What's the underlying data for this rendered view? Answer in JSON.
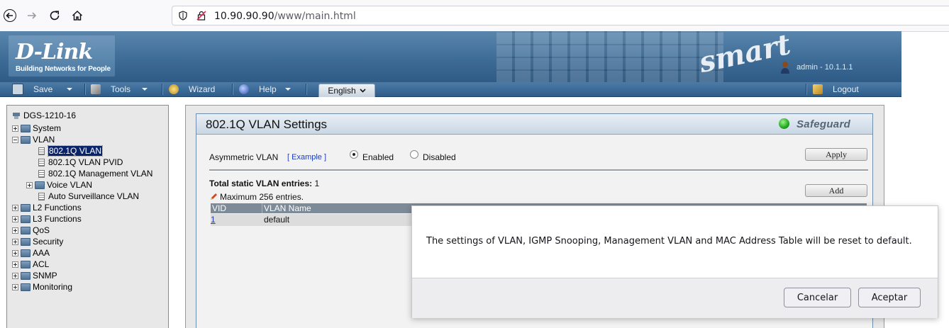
{
  "browser": {
    "url_host": "10.90.90.90",
    "url_path": "/www/main.html",
    "icons": [
      "back-arrow-icon",
      "forward-arrow-icon",
      "reload-icon",
      "home-icon",
      "shield-icon",
      "insecure-lock-icon"
    ]
  },
  "header": {
    "logo_text": "D-Link",
    "logo_tagline": "Building Networks for People",
    "smart_logo": "smart",
    "user": "admin - 10.1.1.1"
  },
  "toolbar": {
    "save": "Save",
    "tools": "Tools",
    "wizard": "Wizard",
    "help": "Help",
    "language": "English",
    "logout": "Logout"
  },
  "tree": {
    "root": "DGS-1210-16",
    "system": "System",
    "vlan": "VLAN",
    "vlan_8021q": "802.1Q VLAN",
    "vlan_pvid": "802.1Q VLAN PVID",
    "vlan_mgmt": "802.1Q Management VLAN",
    "voice_vlan": "Voice VLAN",
    "auto_surv": "Auto Surveillance VLAN",
    "l2": "L2 Functions",
    "l3": "L3 Functions",
    "qos": "QoS",
    "security": "Security",
    "aaa": "AAA",
    "acl": "ACL",
    "snmp": "SNMP",
    "monitoring": "Monitoring"
  },
  "panel": {
    "title": "802.1Q VLAN Settings",
    "safeguard": "Safeguard",
    "asym_label": "Asymmetric VLAN",
    "example": "[ Example ]",
    "enabled": "Enabled",
    "disabled": "Disabled",
    "asym_state": "Enabled",
    "apply": "Apply",
    "total_label": "Total static VLAN entries:",
    "total_value": "1",
    "max_entries": "Maximum 256 entries.",
    "add": "Add",
    "columns": [
      "VID",
      "VLAN Name"
    ],
    "rows": [
      {
        "vid": "1",
        "name": "default"
      }
    ]
  },
  "dialog": {
    "message": "The settings of VLAN, IGMP Snooping, Management VLAN and MAC Address Table will be reset to default.",
    "cancel": "Cancelar",
    "accept": "Aceptar"
  },
  "colors": {
    "header_blue": "#3d6c97",
    "selected_tree": "#0a246a",
    "link_blue": "#1e3dbd",
    "safeguard_green": "#1ea81e"
  }
}
